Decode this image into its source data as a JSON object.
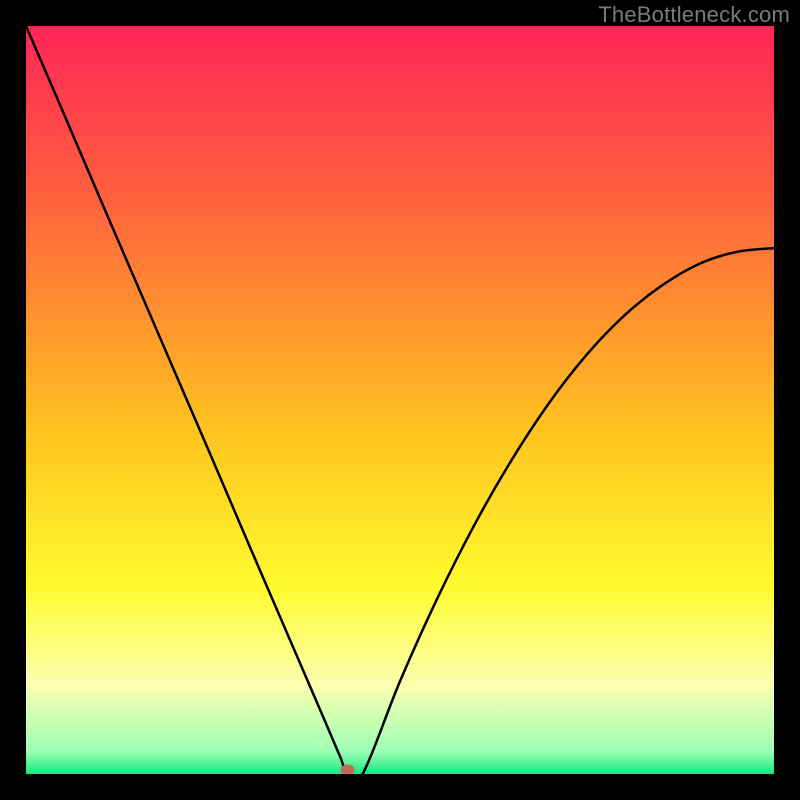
{
  "watermark": "TheBottleneck.com",
  "chart_data": {
    "type": "line",
    "title": "",
    "xlabel": "",
    "ylabel": "",
    "xlim": [
      0,
      100
    ],
    "ylim": [
      0,
      100
    ],
    "grid": false,
    "legend": false,
    "series": [
      {
        "name": "curve",
        "x": [
          0,
          5,
          10,
          15,
          20,
          25,
          30,
          35,
          40,
          42,
          43,
          45,
          50,
          55,
          60,
          65,
          70,
          75,
          80,
          85,
          90,
          95,
          100
        ],
        "y": [
          100,
          88.4,
          76.7,
          65.1,
          53.5,
          41.9,
          30.2,
          18.6,
          7.0,
          2.3,
          0,
          0,
          12.4,
          23.5,
          33.4,
          42.1,
          49.7,
          56.1,
          61.3,
          65.3,
          68.2,
          69.8,
          70.3
        ]
      }
    ],
    "marker": {
      "x": 43,
      "y": 0,
      "color": "#c46a57"
    },
    "gradient_stops": [
      {
        "offset": 0,
        "color": "#ff2458"
      },
      {
        "offset": 25,
        "color": "#ff673c"
      },
      {
        "offset": 55,
        "color": "#ffc61f"
      },
      {
        "offset": 75,
        "color": "#fffb2e"
      },
      {
        "offset": 88,
        "color": "#fdffb0"
      },
      {
        "offset": 97,
        "color": "#9cffb4"
      },
      {
        "offset": 100,
        "color": "#17e87f"
      }
    ]
  }
}
